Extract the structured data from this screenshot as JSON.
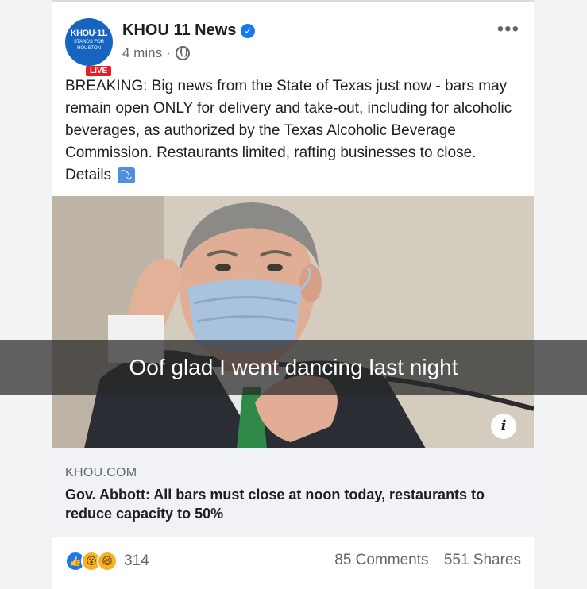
{
  "post": {
    "page_name": "KHOU 11 News",
    "avatar": {
      "line1": "KHOU·11.",
      "line2": "STANDS FOR",
      "line3": "HOUSTON"
    },
    "live_badge": "LIVE",
    "time": "4 mins",
    "meta_separator": "·",
    "text": "BREAKING: Big news from the State of Texas just now - bars may remain open ONLY for delivery and take-out, including for alcoholic beverages, as authorized by the Texas Alcoholic Beverage Commission. Restaurants limited, rafting businesses to close. Details",
    "details_icon": "⤵"
  },
  "snap_caption": "Oof glad I went dancing last night",
  "link_preview": {
    "domain": "KHOU.COM",
    "title": "Gov. Abbott: All bars must close at noon today, restaurants to reduce capacity to 50%",
    "info_icon": "i"
  },
  "footer": {
    "reaction_count": "314",
    "comments": "85 Comments",
    "shares": "551 Shares"
  },
  "colors": {
    "accent": "#1877f2",
    "live_red": "#e41e26"
  }
}
